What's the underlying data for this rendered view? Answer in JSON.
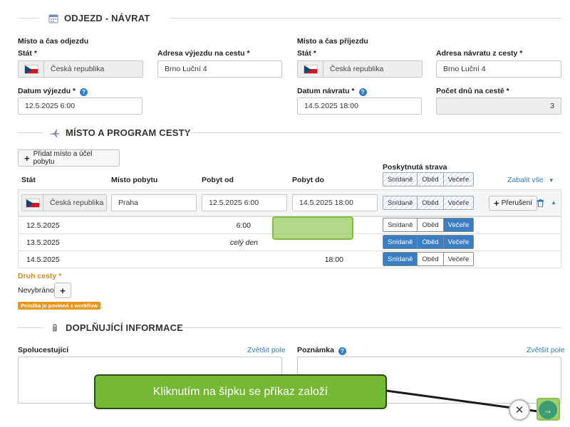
{
  "sections": {
    "departure_return": "ODJEZD - NÁVRAT",
    "place_program": "MÍSTO A PROGRAM CESTY",
    "additional_info": "DOPLŇUJÍCÍ INFORMACE"
  },
  "departure": {
    "group_label": "Místo a čas odjezdu",
    "state_label": "Stát *",
    "state_value": "Česká republika",
    "address_label": "Adresa výjezdu na cestu *",
    "address_value": "Brno Luční 4",
    "date_label": "Datum výjezdu *",
    "date_value": "12.5.2025 6:00"
  },
  "arrival": {
    "group_label": "Místo a čas příjezdu",
    "state_label": "Stát *",
    "state_value": "Česká republika",
    "address_label": "Adresa návratu z cesty *",
    "address_value": "Brno Luční 4",
    "date_label": "Datum návratu *",
    "date_value": "14.5.2025 18:00",
    "days_label": "Počet dnů na cestě *",
    "days_value": "3"
  },
  "program": {
    "add_button": "Přidat místo a účel pobytu",
    "columns": {
      "state": "Stát",
      "place": "Místo pobytu",
      "from": "Pobyt od",
      "to": "Pobyt do",
      "meals": "Poskytnutá strava"
    },
    "meal_labels": [
      "Snídaně",
      "Oběd",
      "Večeře"
    ],
    "collapse_all": "Zabalit vše",
    "stay": {
      "state": "Česká republika",
      "place": "Praha",
      "from": "12.5.2025 6:00",
      "to": "14.5.2025 18:00",
      "interruption_button": "Přerušení"
    },
    "days": [
      {
        "date": "12.5.2025",
        "from": "6:00",
        "to": "",
        "meals": [
          false,
          false,
          true
        ]
      },
      {
        "date": "13.5.2025",
        "from": "celý den",
        "to": "",
        "meals": [
          true,
          true,
          true
        ]
      },
      {
        "date": "14.5.2025",
        "from": "",
        "to": "18:00",
        "meals": [
          true,
          false,
          false
        ]
      }
    ],
    "trip_type_label": "Druh cesty *",
    "trip_type_value": "Nevybráno",
    "workflow_badge": "Položka je povinná z workflow"
  },
  "additional": {
    "companions_label": "Spolucestující",
    "enlarge_link": "Zvětšit pole",
    "note_label": "Poznámka",
    "note_enlarge_link": "Zvětšit pole"
  },
  "tutorial": {
    "callout_text": "Kliknutím na šipku se příkaz založí"
  },
  "colors": {
    "accent": "#3a7fc6",
    "highlight": "#8bc34a",
    "callout": "#74b833",
    "required_orange": "#d58a1d"
  },
  "icons": {
    "calendar": "calendar-icon",
    "plane": "plane-icon",
    "paperclip": "paperclip-icon",
    "trash": "trash-icon",
    "close": "close-icon",
    "arrow": "arrow-right-icon"
  }
}
